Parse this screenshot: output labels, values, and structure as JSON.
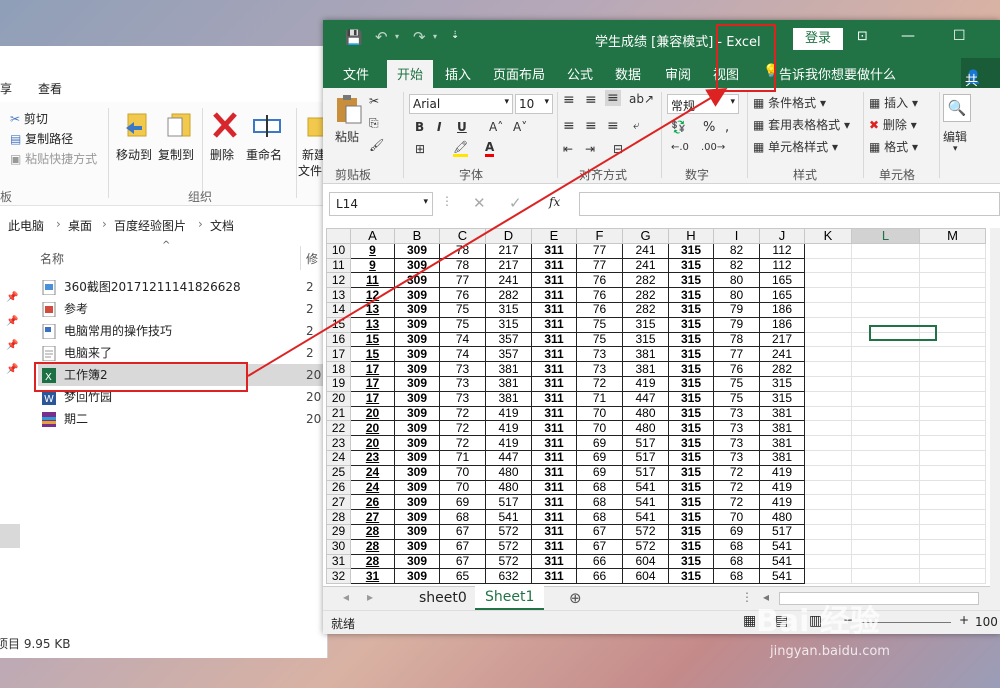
{
  "explorer": {
    "tabs": [
      "享",
      "查看"
    ],
    "ribbon": {
      "cut": "剪切",
      "copy_path": "复制路径",
      "paste_shortcut": "粘贴快捷方式",
      "move_to": "移动到",
      "copy_to": "复制到",
      "delete": "删除",
      "rename": "重命名",
      "new": "新建",
      "new2": "文件",
      "group_left": "板",
      "group_organize": "组织"
    },
    "breadcrumb": [
      "此电脑",
      "桌面",
      "百度经验图片",
      "文档"
    ],
    "col_name": "名称",
    "col_modified": "修",
    "files": [
      {
        "name": "360截图20171211141826628",
        "date": "2"
      },
      {
        "name": "参考",
        "date": "2"
      },
      {
        "name": "电脑常用的操作技巧",
        "date": "2"
      },
      {
        "name": "电脑来了",
        "date": "2"
      },
      {
        "name": "工作簿2",
        "date": "20"
      },
      {
        "name": "梦回竹园",
        "date": "20"
      },
      {
        "name": "期二",
        "date": "20"
      }
    ],
    "status": "项目 9.95 KB"
  },
  "excel": {
    "doc_title": "学生成绩  [兼容模式]  -  Excel",
    "login": "登录",
    "tabs": [
      "文件",
      "开始",
      "插入",
      "页面布局",
      "公式",
      "数据",
      "审阅",
      "视图"
    ],
    "active_tab": "开始",
    "tell_me": "告诉我你想要做什么",
    "share": "共享",
    "ribbon": {
      "paste": "粘贴",
      "clipboard": "剪贴板",
      "font_name": "Arial",
      "font_size": "10",
      "font_group": "字体",
      "align_group": "对齐方式",
      "number_format": "常规",
      "number_group": "数字",
      "cond_format": "条件格式",
      "table_format": "套用表格格式",
      "cell_style": "单元格样式",
      "styles_group": "样式",
      "insert": "插入",
      "delete": "删除",
      "format": "格式",
      "cells_group": "单元格",
      "edit": "编辑"
    },
    "name_box": "L14",
    "fx": "fx",
    "columns": [
      "A",
      "B",
      "C",
      "D",
      "E",
      "F",
      "G",
      "H",
      "I",
      "J",
      "K",
      "L",
      "M"
    ],
    "rows": [
      [
        10,
        "9",
        "309",
        "78",
        "217",
        "311",
        "77",
        "241",
        "315",
        "82",
        "112"
      ],
      [
        11,
        "9",
        "309",
        "78",
        "217",
        "311",
        "77",
        "241",
        "315",
        "82",
        "112"
      ],
      [
        12,
        "11",
        "309",
        "77",
        "241",
        "311",
        "76",
        "282",
        "315",
        "80",
        "165"
      ],
      [
        13,
        "12",
        "309",
        "76",
        "282",
        "311",
        "76",
        "282",
        "315",
        "80",
        "165"
      ],
      [
        14,
        "13",
        "309",
        "75",
        "315",
        "311",
        "76",
        "282",
        "315",
        "79",
        "186"
      ],
      [
        15,
        "13",
        "309",
        "75",
        "315",
        "311",
        "75",
        "315",
        "315",
        "79",
        "186"
      ],
      [
        16,
        "15",
        "309",
        "74",
        "357",
        "311",
        "75",
        "315",
        "315",
        "78",
        "217"
      ],
      [
        17,
        "15",
        "309",
        "74",
        "357",
        "311",
        "73",
        "381",
        "315",
        "77",
        "241"
      ],
      [
        18,
        "17",
        "309",
        "73",
        "381",
        "311",
        "73",
        "381",
        "315",
        "76",
        "282"
      ],
      [
        19,
        "17",
        "309",
        "73",
        "381",
        "311",
        "72",
        "419",
        "315",
        "75",
        "315"
      ],
      [
        20,
        "17",
        "309",
        "73",
        "381",
        "311",
        "71",
        "447",
        "315",
        "75",
        "315"
      ],
      [
        21,
        "20",
        "309",
        "72",
        "419",
        "311",
        "70",
        "480",
        "315",
        "73",
        "381"
      ],
      [
        22,
        "20",
        "309",
        "72",
        "419",
        "311",
        "70",
        "480",
        "315",
        "73",
        "381"
      ],
      [
        23,
        "20",
        "309",
        "72",
        "419",
        "311",
        "69",
        "517",
        "315",
        "73",
        "381"
      ],
      [
        24,
        "23",
        "309",
        "71",
        "447",
        "311",
        "69",
        "517",
        "315",
        "73",
        "381"
      ],
      [
        25,
        "24",
        "309",
        "70",
        "480",
        "311",
        "69",
        "517",
        "315",
        "72",
        "419"
      ],
      [
        26,
        "24",
        "309",
        "70",
        "480",
        "311",
        "68",
        "541",
        "315",
        "72",
        "419"
      ],
      [
        27,
        "26",
        "309",
        "69",
        "517",
        "311",
        "68",
        "541",
        "315",
        "72",
        "419"
      ],
      [
        28,
        "27",
        "309",
        "68",
        "541",
        "311",
        "68",
        "541",
        "315",
        "70",
        "480"
      ],
      [
        29,
        "28",
        "309",
        "67",
        "572",
        "311",
        "67",
        "572",
        "315",
        "69",
        "517"
      ],
      [
        30,
        "28",
        "309",
        "67",
        "572",
        "311",
        "67",
        "572",
        "315",
        "68",
        "541"
      ],
      [
        31,
        "28",
        "309",
        "67",
        "572",
        "311",
        "66",
        "604",
        "315",
        "68",
        "541"
      ],
      [
        32,
        "31",
        "309",
        "65",
        "632",
        "311",
        "66",
        "604",
        "315",
        "68",
        "541"
      ]
    ],
    "sheet_tabs": [
      "sheet0",
      "Sheet1"
    ],
    "active_sheet": "Sheet1",
    "status_ready": "就绪",
    "zoom": "100",
    "accent": "#217346"
  },
  "watermark": {
    "brand": "Bai 经验",
    "url": "jingyan.baidu.com"
  }
}
